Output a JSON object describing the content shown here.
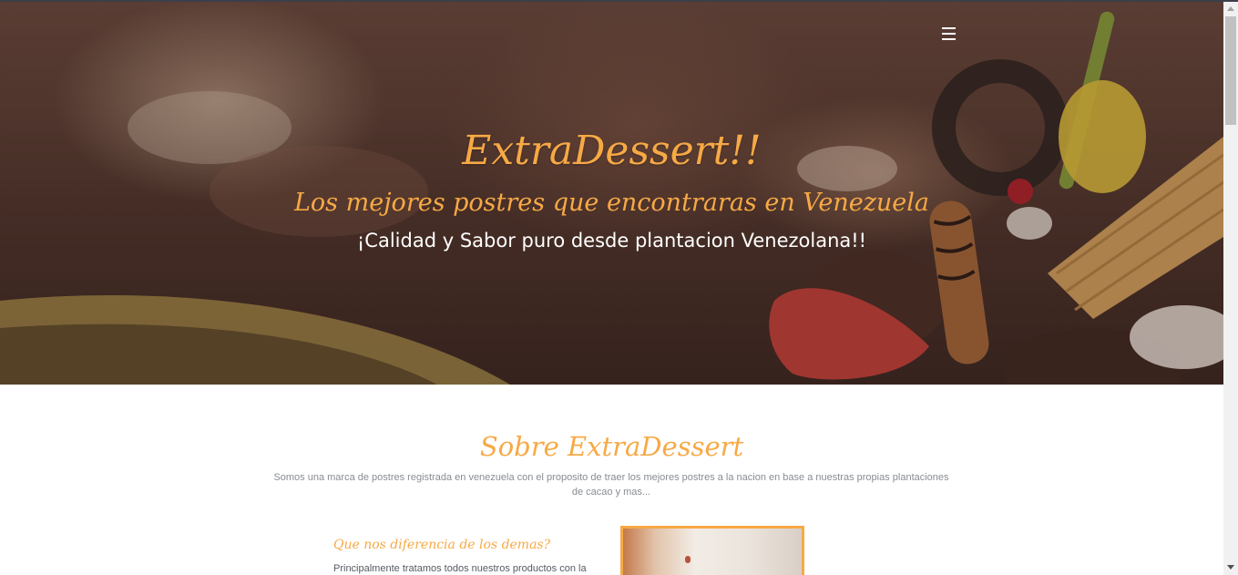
{
  "header": {
    "menu_icon": "hamburger-menu-icon"
  },
  "hero": {
    "title": "ExtraDessert!!",
    "subtitle": "Los mejores postres que encontraras en Venezuela",
    "tagline": "¡Calidad y Sabor puro desde plantacion Venezolana!!"
  },
  "about": {
    "title": "Sobre ExtraDessert",
    "description": "Somos una marca de postres registrada en venezuela con el proposito de traer los mejores postres a la nacion en base a nuestras propias plantaciones de cacao y mas...",
    "difference_heading": "Que nos diferencia de los demas?",
    "difference_text": "Principalmente tratamos todos nuestros productos con la"
  },
  "colors": {
    "accent": "#f7a945",
    "text_muted": "#888c93",
    "hero_text": "#ffffff"
  }
}
